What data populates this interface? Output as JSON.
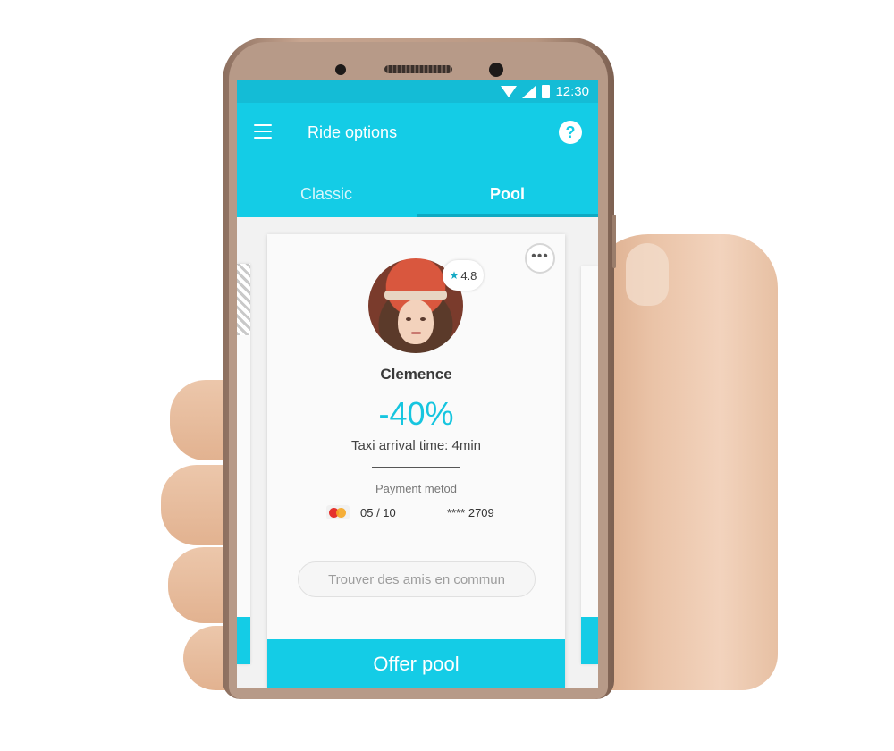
{
  "status_bar": {
    "time": "12:30",
    "icons": [
      "wifi-icon",
      "signal-icon",
      "battery-icon"
    ]
  },
  "app_bar": {
    "title": "Ride options",
    "menu_icon": "menu-icon",
    "help_icon": "help-icon",
    "help_glyph": "?"
  },
  "tabs": [
    {
      "label": "Classic",
      "selected": false
    },
    {
      "label": "Pool",
      "selected": true
    }
  ],
  "card": {
    "driver_name": "Clemence",
    "rating": "4.8",
    "rating_icon": "star-icon",
    "more_glyph": "•••",
    "discount": "-40%",
    "arrival": "Taxi arrival time: 4min",
    "payment_label": "Payment metod",
    "card_brand": "mastercard-logo",
    "card_expiry": "05 / 10",
    "card_number": "**** 2709",
    "friends_placeholder": "Trouver des amis en commun",
    "offer_label": "Offer pool"
  },
  "colors": {
    "accent": "#14cce6",
    "status_bar": "#14bcd6",
    "tab_indicator": "#0fa9c2",
    "discount": "#16c5df"
  }
}
